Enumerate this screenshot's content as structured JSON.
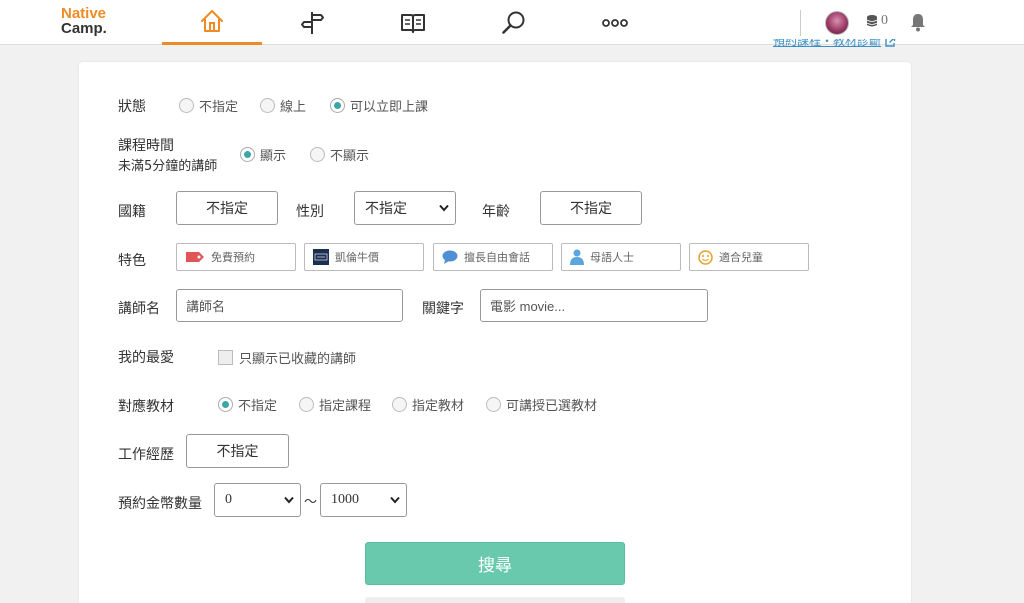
{
  "header": {
    "logo_line1": "Native",
    "logo_line2": "Camp.",
    "nav": [
      {
        "icon": "home-icon",
        "active": true
      },
      {
        "icon": "signpost-icon",
        "active": false
      },
      {
        "icon": "book-icon",
        "active": false
      },
      {
        "icon": "search-icon",
        "active": false
      },
      {
        "icon": "more-icon",
        "active": false
      }
    ],
    "coins": "0"
  },
  "top_link": "預約課程・教材診斷",
  "form": {
    "status": {
      "label": "狀態",
      "options": [
        "不指定",
        "線上",
        "可以立即上課"
      ],
      "selected": 2
    },
    "lesson_time": {
      "label_line1": "課程時間",
      "label_line2": "未滿5分鐘的講師",
      "options": [
        "顯示",
        "不顯示"
      ],
      "selected": 0
    },
    "nationality": {
      "label": "國籍",
      "value": "不指定"
    },
    "gender": {
      "label": "性別",
      "value": "不指定"
    },
    "age": {
      "label": "年齡",
      "value": "不指定"
    },
    "features": {
      "label": "特色",
      "items": [
        {
          "text": "免費預約",
          "icon": "tag-icon"
        },
        {
          "text": "凱倫牛價",
          "icon": "badge-icon"
        },
        {
          "text": "擅長自由會話",
          "icon": "speech-bubble-icon"
        },
        {
          "text": "母語人士",
          "icon": "person-icon"
        },
        {
          "text": "適合兒童",
          "icon": "smile-icon"
        }
      ]
    },
    "teacher_name": {
      "label": "講師名",
      "placeholder": "講師名"
    },
    "keyword": {
      "label": "關鍵字",
      "placeholder": "電影 movie..."
    },
    "favorites": {
      "label": "我的最愛",
      "checkbox_text": "只顯示已收藏的講師",
      "checked": false
    },
    "material": {
      "label": "對應教材",
      "options": [
        "不指定",
        "指定課程",
        "指定教材",
        "可講授已選教材"
      ],
      "selected": 0
    },
    "experience": {
      "label": "工作經歷",
      "value": "不指定"
    },
    "coin_range": {
      "label": "預約金幣數量",
      "min": "0",
      "separator": "～",
      "max": "1000"
    },
    "search_button": "搜尋"
  },
  "colors": {
    "accent": "#f08a24",
    "radio": "#3aa6a5",
    "search_button": "#68c9ad",
    "link": "#3a8fc7"
  }
}
